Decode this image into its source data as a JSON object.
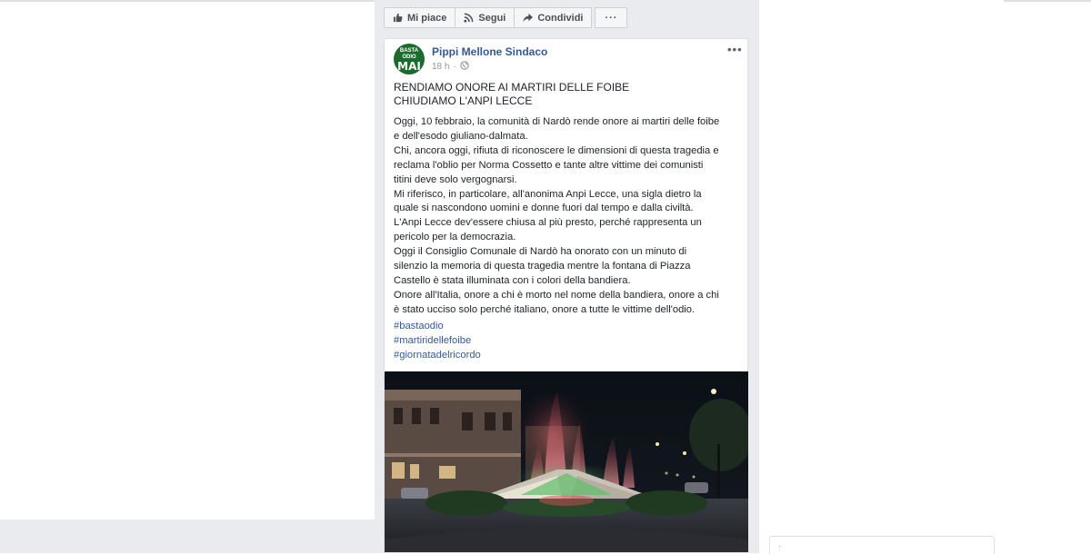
{
  "toolbar": {
    "like_label": "Mi piace",
    "follow_label": "Segui",
    "share_label": "Condividi",
    "more_label": "···"
  },
  "post": {
    "page_name": "Pippi Mellone Sindaco",
    "avatar_text_top": "BASTA ODIO",
    "avatar_text_main": "MAI",
    "time": "18 h",
    "audience_icon": "globe-icon",
    "options_label": "•••",
    "headline": [
      "RENDIAMO ONORE AI MARTIRI DELLE FOIBE",
      "CHIUDIAMO L'ANPI LECCE"
    ],
    "body_lines": [
      "Oggi, 10 febbraio, la comunità di Nardò rende onore ai martiri delle foibe",
      "e dell'esodo giuliano-dalmata.",
      "Chi, ancora oggi, rifiuta di riconoscere le dimensioni di questa tragedia e",
      "reclama l'oblio per Norma Cossetto e tante altre vittime dei comunisti",
      "titini deve solo vergognarsi.",
      "Mi riferisco, in particolare, all'anonima Anpi Lecce, una sigla dietro la",
      "quale si nascondono uomini e donne fuori dal tempo e dalla civiltà.",
      "L'Anpi Lecce dev'essere chiusa al più presto, perché rappresenta un",
      "pericolo per la democrazia.",
      "Oggi il Consiglio Comunale di Nardò ha onorato con un minuto di",
      "silenzio la memoria di questa tragedia mentre la fontana di Piazza",
      "Castello è stata illuminata con i colori della bandiera.",
      "Onore all'Italia, onore a chi è morto nel nome della bandiera, onore a chi",
      "è stato ucciso solo perché italiano, onore a tutte le vittime dell'odio."
    ],
    "hashtags": [
      "#bastaodio",
      "#martiridellefoibe",
      "#giornatadelricordo"
    ]
  },
  "colors": {
    "link": "#365899",
    "feed_bg": "#e9ebee",
    "text": "#1d2129",
    "meta": "#90949c"
  }
}
